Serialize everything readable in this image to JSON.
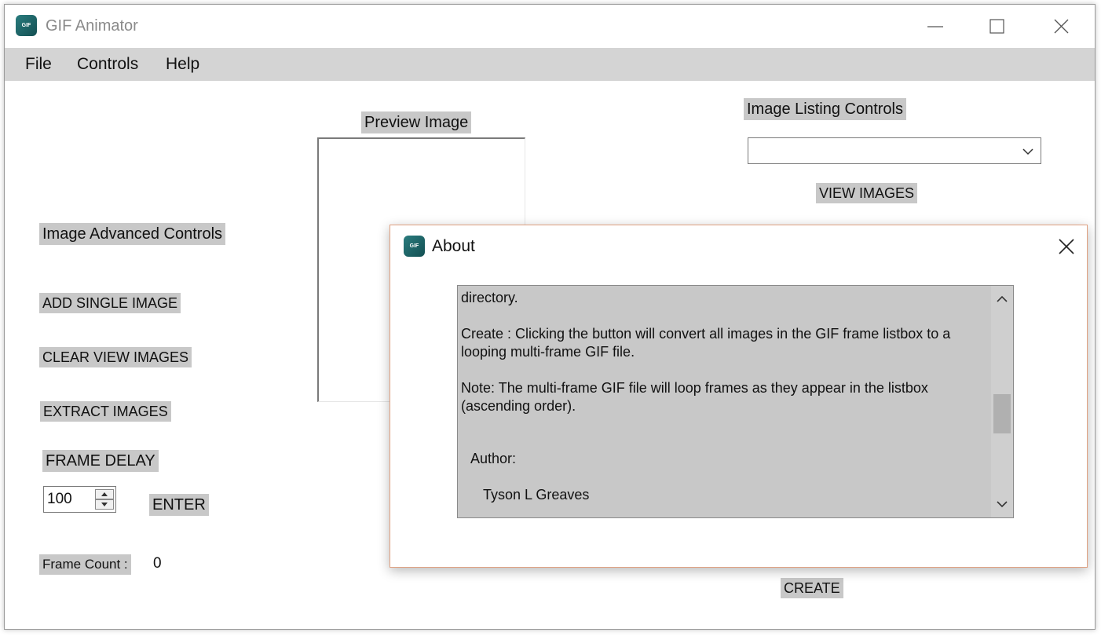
{
  "window": {
    "title": "GIF Animator",
    "icon_text": "GIF"
  },
  "menu": {
    "items": [
      "File",
      "Controls",
      "Help"
    ]
  },
  "main": {
    "preview_label": "Preview Image",
    "listing_label": "Image Listing Controls",
    "combo_value": "",
    "view_images_label": "VIEW IMAGES",
    "advanced_label": "Image Advanced Controls",
    "add_single_label": "ADD SINGLE IMAGE",
    "clear_view_label": "CLEAR VIEW IMAGES",
    "extract_label": "EXTRACT IMAGES",
    "frame_delay_label": "FRAME DELAY",
    "frame_delay_value": "100",
    "enter_label": "ENTER",
    "frame_count_label": "Frame Count :",
    "frame_count_value": "0",
    "create_label": "CREATE"
  },
  "about": {
    "title": "About",
    "lines": [
      "directory.",
      "Create : Clicking the button will convert all images in the GIF frame listbox to a looping multi-frame GIF file.",
      "Note: The multi-frame GIF file will loop frames as they appear in the listbox (ascending order).",
      "Author:",
      "Tyson L Greaves"
    ]
  },
  "icons": [
    "minimize-icon",
    "maximize-icon",
    "close-icon",
    "chevron-down-icon",
    "chevron-up-icon",
    "app-icon"
  ],
  "colors": {
    "label_bg": "#c8c8c8",
    "menubar_bg": "#d4d4d4",
    "dialog_border": "#e0a080",
    "app_icon": "#1f6466"
  }
}
